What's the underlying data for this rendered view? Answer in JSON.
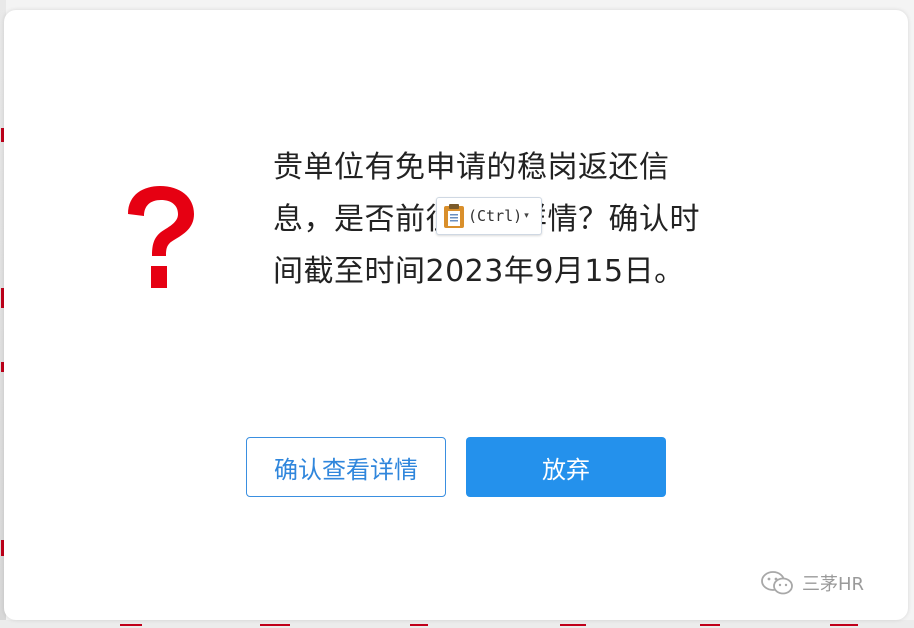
{
  "dialog": {
    "message": "贵单位有免申请的稳岗返还信息，是否前往查看详情？确认时间截至时间2023年9月15日。",
    "icon": "question-mark-icon",
    "paste_chip": {
      "icon": "clipboard-icon",
      "label": "(Ctrl)",
      "caret": "▾"
    },
    "buttons": {
      "confirm_label": "确认查看详情",
      "cancel_label": "放弃"
    }
  },
  "watermark": {
    "icon": "wechat-icon",
    "text": "三茅HR"
  },
  "colors": {
    "question_mark": "#e60012",
    "primary": "#2491ec",
    "primary_text": "#2f86dc",
    "body_text": "#222222"
  }
}
